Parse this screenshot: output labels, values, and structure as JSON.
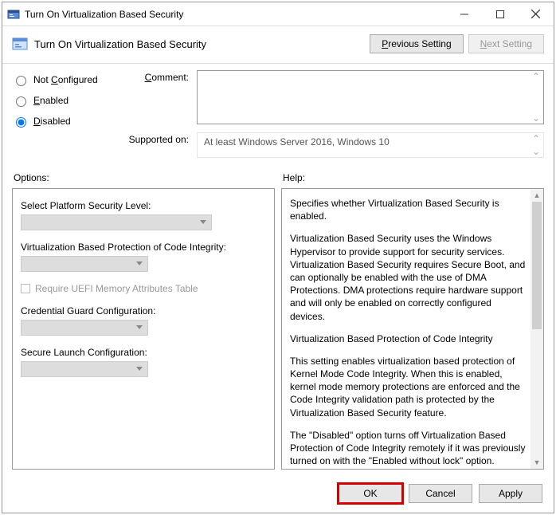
{
  "title": "Turn On Virtualization Based Security",
  "header_title": "Turn On Virtualization Based Security",
  "nav": {
    "prev": "Previous Setting",
    "next": "Next Setting"
  },
  "radios": {
    "not": {
      "pre": "Not ",
      "u": "C",
      "post": "onfigured"
    },
    "enabled": {
      "u": "E",
      "post": "nabled"
    },
    "disabled": {
      "u": "D",
      "post": "isabled"
    },
    "selected": "disabled"
  },
  "labels": {
    "comment": {
      "u": "C",
      "post": "omment:"
    },
    "supported": "Supported on:"
  },
  "supported": "At least Windows Server 2016, Windows 10",
  "panel": {
    "options": "Options:",
    "help": "Help:"
  },
  "options": {
    "platform": "Select Platform Security Level:",
    "vbp": "Virtualization Based Protection of Code Integrity:",
    "uefi_chk": "Require UEFI Memory Attributes Table",
    "cred": "Credential Guard Configuration:",
    "secure": "Secure Launch Configuration:"
  },
  "help": {
    "p1": "Specifies whether Virtualization Based Security is enabled.",
    "p2": "Virtualization Based Security uses the Windows Hypervisor to provide support for security services. Virtualization Based Security requires Secure Boot, and can optionally be enabled with the use of DMA Protections. DMA protections require hardware support and will only be enabled on correctly configured devices.",
    "p3": "Virtualization Based Protection of Code Integrity",
    "p4": "This setting enables virtualization based protection of Kernel Mode Code Integrity. When this is enabled, kernel mode memory protections are enforced and the Code Integrity validation path is protected by the Virtualization Based Security feature.",
    "p5": "The \"Disabled\" option turns off Virtualization Based Protection of Code Integrity remotely if it was previously turned on with the \"Enabled without lock\" option."
  },
  "buttons": {
    "ok": "OK",
    "cancel": "Cancel",
    "apply": "Apply"
  }
}
